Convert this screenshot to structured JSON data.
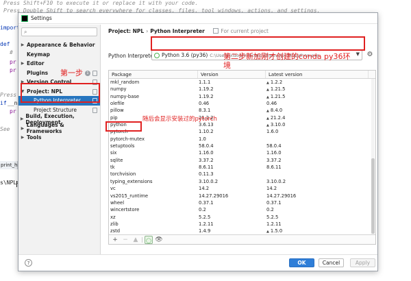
{
  "editor": {
    "comment_lines": [
      "Press Shift+F10 to execute it or replace it with your code.",
      "Press Double Shift to search everywhere for classes, files, tool windows, actions, and settings."
    ],
    "keywords": [
      "import",
      "def",
      "pr",
      "pr",
      "if",
      "__na",
      "pr"
    ],
    "comment_fragments": [
      "# ",
      "Press",
      "See"
    ],
    "run_tab": "print_hi()",
    "terminal_text": "s\\NPL>"
  },
  "dialog": {
    "title": "Settings",
    "search_icon": "search-icon",
    "sidebar": {
      "items": [
        {
          "label": "Appearance & Behavior",
          "expandable": true
        },
        {
          "label": "Keymap",
          "expandable": false
        },
        {
          "label": "Editor",
          "expandable": true
        },
        {
          "label": "Plugins",
          "expandable": false,
          "badge": "1"
        },
        {
          "label": "Version Control",
          "expandable": true
        },
        {
          "label": "Project: NPL",
          "expandable": true,
          "expanded": true
        },
        {
          "label": "Python Interpreter",
          "sub": true,
          "selected": true
        },
        {
          "label": "Project Structure",
          "sub": true
        },
        {
          "label": "Build, Execution, Deployment",
          "expandable": true
        },
        {
          "label": "Languages & Frameworks",
          "expandable": true
        },
        {
          "label": "Tools",
          "expandable": true
        }
      ]
    },
    "breadcrumb": {
      "project": "Project: NPL",
      "separator": "›",
      "page": "Python Interpreter",
      "scope": "For current project"
    },
    "interpreter": {
      "label": "Python Interpreter:",
      "name": "Python 3.6 (py36)",
      "path": "C:\\Users\\xiaoj\\miniconda3\\envs\\py36\\python.exe"
    },
    "table": {
      "headers": [
        "Package",
        "Version",
        "Latest version"
      ],
      "rows": [
        {
          "package": "mkl_random",
          "version": "1.1.1",
          "latest": "1.2.2",
          "upgrade": true
        },
        {
          "package": "numpy",
          "version": "1.19.2",
          "latest": "1.21.5",
          "upgrade": true
        },
        {
          "package": "numpy-base",
          "version": "1.19.2",
          "latest": "1.21.5",
          "upgrade": true
        },
        {
          "package": "olefile",
          "version": "0.46",
          "latest": "0.46",
          "upgrade": false
        },
        {
          "package": "pillow",
          "version": "8.3.1",
          "latest": "8.4.0",
          "upgrade": true
        },
        {
          "package": "pip",
          "version": "21.2.2",
          "latest": "21.2.4",
          "upgrade": true
        },
        {
          "package": "python",
          "version": "3.6.13",
          "latest": "3.10.0",
          "upgrade": true
        },
        {
          "package": "pytorch",
          "version": "1.10.2",
          "latest": "1.6.0",
          "upgrade": false
        },
        {
          "package": "pytorch-mutex",
          "version": "1.0",
          "latest": "",
          "upgrade": false
        },
        {
          "package": "setuptools",
          "version": "58.0.4",
          "latest": "58.0.4",
          "upgrade": false
        },
        {
          "package": "six",
          "version": "1.16.0",
          "latest": "1.16.0",
          "upgrade": false
        },
        {
          "package": "sqlite",
          "version": "3.37.2",
          "latest": "3.37.2",
          "upgrade": false
        },
        {
          "package": "tk",
          "version": "8.6.11",
          "latest": "8.6.11",
          "upgrade": false
        },
        {
          "package": "torchvision",
          "version": "0.11.3",
          "latest": "",
          "upgrade": false
        },
        {
          "package": "typing_extensions",
          "version": "3.10.0.2",
          "latest": "3.10.0.2",
          "upgrade": false
        },
        {
          "package": "vc",
          "version": "14.2",
          "latest": "14.2",
          "upgrade": false
        },
        {
          "package": "vs2015_runtime",
          "version": "14.27.29016",
          "latest": "14.27.29016",
          "upgrade": false
        },
        {
          "package": "wheel",
          "version": "0.37.1",
          "latest": "0.37.1",
          "upgrade": false
        },
        {
          "package": "wincertstore",
          "version": "0.2",
          "latest": "0.2",
          "upgrade": false
        },
        {
          "package": "xz",
          "version": "5.2.5",
          "latest": "5.2.5",
          "upgrade": false
        },
        {
          "package": "zlib",
          "version": "1.2.11",
          "latest": "1.2.11",
          "upgrade": false
        },
        {
          "package": "zstd",
          "version": "1.4.9",
          "latest": "1.5.0",
          "upgrade": true
        }
      ],
      "toolbar": {
        "add": "+",
        "remove": "−",
        "upgrade": "▲",
        "conda": "◯",
        "show": "👁"
      }
    },
    "buttons": {
      "help": "?",
      "ok": "OK",
      "cancel": "Cancel",
      "apply": "Apply"
    }
  },
  "annotations": {
    "step1": "第一步",
    "step2": "第二步新加刚才创建的conda py36环境",
    "pytorch_note": "随后会显示安装过的pytorch"
  },
  "colors": {
    "accent": "#2675bf",
    "annotation": "#e02020",
    "ok_button": "#2f7ed8"
  }
}
